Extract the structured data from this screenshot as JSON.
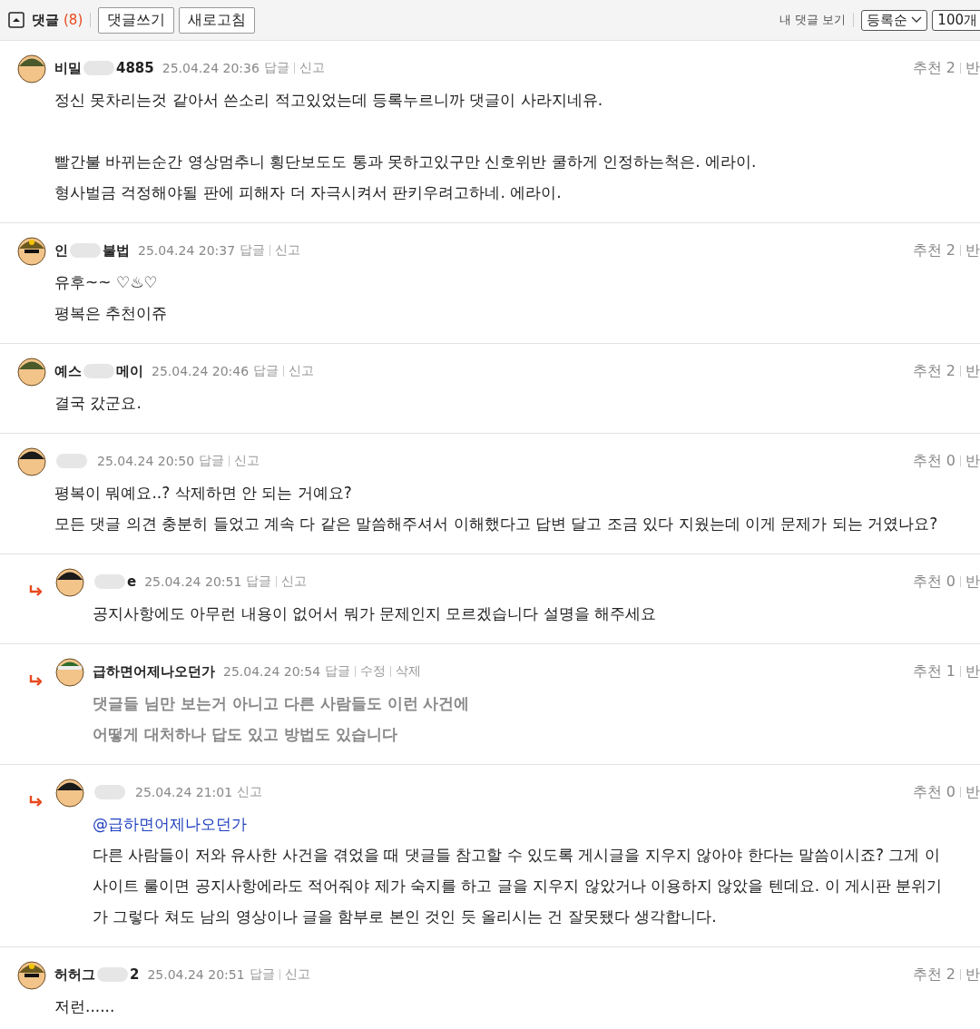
{
  "header": {
    "title": "댓글",
    "count": "(8)",
    "buttons": [
      "댓글쓰기",
      "새로고침"
    ],
    "my_comments": "내 댓글 보기",
    "sort": "등록순",
    "page_size": "100개"
  },
  "comments": [
    {
      "reply": false,
      "kind": "helmet",
      "author": [
        {
          "kind": "text",
          "text": "비밀"
        },
        {
          "kind": "redacted"
        },
        {
          "kind": "text",
          "text": "4885"
        }
      ],
      "time": "25.04.24 20:36",
      "actions": [
        "답글",
        "신고"
      ],
      "votes": "추천 2",
      "vote_down": "반",
      "own": false,
      "paragraphs": [
        [
          "정신 못차리는것 같아서 쓴소리 적고있었는데 등록누르니까 댓글이 사라지네유."
        ],
        [
          "빨간불 바뀌는순간 영상멈추니 횡단보도도 통과 못하고있구만 신호위반 쿨하게 인정하는척은. 에라이.",
          "형사벌금 걱정해야될 판에 피해자 더 자극시켜서 판키우려고하네. 에라이."
        ]
      ]
    },
    {
      "reply": false,
      "kind": "crown",
      "author": [
        {
          "kind": "text",
          "text": "인"
        },
        {
          "kind": "redacted"
        },
        {
          "kind": "text",
          "text": "불법"
        }
      ],
      "time": "25.04.24 20:37",
      "actions": [
        "답글",
        "신고"
      ],
      "votes": "추천 2",
      "vote_down": "반",
      "own": false,
      "paragraphs": [
        [
          "유후~~ ♡♨♡",
          "평복은 추천이쥬"
        ]
      ]
    },
    {
      "reply": false,
      "kind": "helmet",
      "author": [
        {
          "kind": "text",
          "text": "예스"
        },
        {
          "kind": "redacted"
        },
        {
          "kind": "text",
          "text": "메이"
        }
      ],
      "time": "25.04.24 20:46",
      "actions": [
        "답글",
        "신고"
      ],
      "votes": "추천 2",
      "vote_down": "반",
      "own": false,
      "paragraphs": [
        [
          "결국 갔군요."
        ]
      ]
    },
    {
      "reply": false,
      "kind": "boy",
      "author": [
        {
          "kind": "redacted"
        }
      ],
      "time": "25.04.24 20:50",
      "actions": [
        "답글",
        "신고"
      ],
      "votes": "추천 0",
      "vote_down": "반",
      "own": false,
      "paragraphs": [
        [
          "평복이 뭐예요..? 삭제하면 안 되는 거예요?",
          "모든 댓글 의견 충분히 들었고 계속 다 같은 말씀해주셔서 이해했다고 답변 달고 조금 있다 지웠는데 이게 문제가 되는 거였나요?"
        ]
      ]
    },
    {
      "reply": true,
      "kind": "boy",
      "author": [
        {
          "kind": "redacted"
        },
        {
          "kind": "text",
          "text": "e"
        }
      ],
      "time": "25.04.24 20:51",
      "actions": [
        "답글",
        "신고"
      ],
      "votes": "추천 0",
      "vote_down": "반",
      "own": false,
      "paragraphs": [
        [
          "공지사항에도 아무런 내용이 없어서 뭐가 문제인지 모르겠습니다 설명을 해주세요"
        ]
      ]
    },
    {
      "reply": true,
      "kind": "officer",
      "author": [
        {
          "kind": "text",
          "text": "급하면어제나오던가"
        }
      ],
      "time": "25.04.24 20:54",
      "actions": [
        "답글",
        "수정",
        "삭제"
      ],
      "votes": "추천 1",
      "vote_down": "반",
      "own": true,
      "paragraphs": [
        [
          "댓글들 님만 보는거 아니고 다른 사람들도 이런 사건에",
          "어떻게 대처하나 답도 있고 방법도 있습니다"
        ]
      ]
    },
    {
      "reply": true,
      "kind": "boy",
      "author": [
        {
          "kind": "redacted"
        }
      ],
      "time": "25.04.24 21:01",
      "actions": [
        "신고"
      ],
      "votes": "추천 0",
      "vote_down": "반",
      "own": false,
      "mention": "@급하면어제나오던가",
      "paragraphs": [
        [
          "다른 사람들이 저와 유사한 사건을 겪었을 때 댓글들 참고할 수 있도록 게시글을 지우지 않아야 한다는 말씀이시죠? 그게 이 사이트 룰이면 공지사항에라도 적어줘야 제가 숙지를 하고 글을 지우지 않았거나 이용하지 않았을 텐데요. 이 게시판 분위기가 그렇다 쳐도 남의 영상이나 글을 함부로 본인 것인 듯 올리시는 건 잘못됐다 생각합니다."
        ]
      ]
    },
    {
      "reply": false,
      "kind": "crown",
      "author": [
        {
          "kind": "text",
          "text": "허허그"
        },
        {
          "kind": "redacted"
        },
        {
          "kind": "text",
          "text": "2"
        }
      ],
      "time": "25.04.24 20:51",
      "actions": [
        "답글",
        "신고"
      ],
      "votes": "추천 2",
      "vote_down": "반",
      "own": false,
      "paragraphs": [
        [
          "저런......"
        ]
      ]
    }
  ]
}
